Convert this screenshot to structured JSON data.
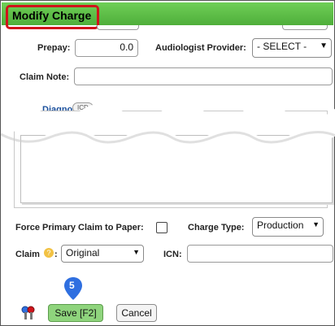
{
  "window": {
    "title": "Modify Charge"
  },
  "fields": {
    "prepay_label": "Prepay:",
    "prepay_value": "0.0",
    "provider_label": "Audiologist Provider:",
    "provider_value": "- SELECT -",
    "claim_note_label": "Claim Note:",
    "diagnosis_label": "Diagnosis",
    "diagnosis_tag": "ICD",
    "force_primary_label": "Force Primary Claim to Paper:",
    "charge_type_label": "Charge Type:",
    "charge_type_value": "Production",
    "claim_label": "Claim",
    "claim_value": "Original",
    "icn_label": "ICN:"
  },
  "buttons": {
    "save": "Save [F2]",
    "cancel": "Cancel"
  },
  "annotation": {
    "step": "5"
  },
  "colors": {
    "titlebar": "#5abf44",
    "highlight": "#d0141b",
    "marker": "#2f6fe0",
    "save_button": "#8fd47d"
  }
}
